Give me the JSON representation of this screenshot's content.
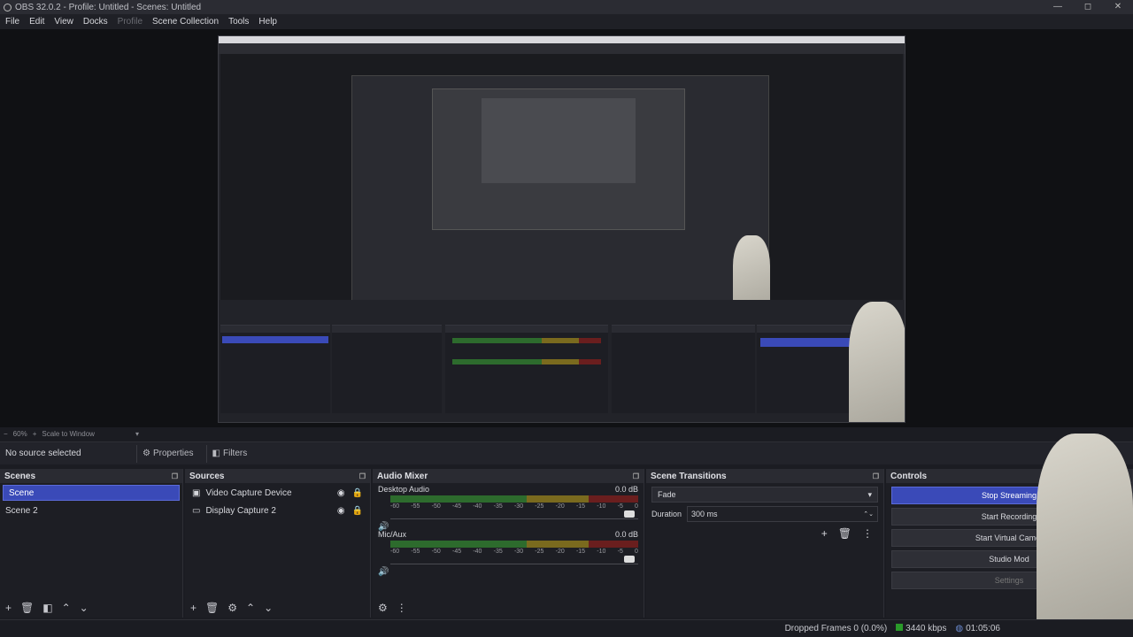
{
  "window": {
    "title": "OBS 32.0.2 - Profile: Untitled - Scenes: Untitled",
    "controls": [
      "—",
      "◻",
      "✕"
    ]
  },
  "menu": {
    "items": [
      {
        "label": "File",
        "disabled": false
      },
      {
        "label": "Edit",
        "disabled": false
      },
      {
        "label": "View",
        "disabled": false
      },
      {
        "label": "Docks",
        "disabled": false
      },
      {
        "label": "Profile",
        "disabled": true
      },
      {
        "label": "Scene Collection",
        "disabled": false
      },
      {
        "label": "Tools",
        "disabled": false
      },
      {
        "label": "Help",
        "disabled": false
      }
    ]
  },
  "preview_bar": {
    "zoom": "60%",
    "scale_mode": "Scale to Window"
  },
  "source_bar": {
    "no_source": "No source selected",
    "properties": "Properties",
    "filters": "Filters"
  },
  "scenes": {
    "title": "Scenes",
    "items": [
      "Scene",
      "Scene 2"
    ],
    "selected_index": 0
  },
  "sources": {
    "title": "Sources",
    "items": [
      {
        "label": "Video Capture Device",
        "icon": "camera-icon"
      },
      {
        "label": "Display Capture 2",
        "icon": "monitor-icon"
      }
    ]
  },
  "audio_mixer": {
    "title": "Audio Mixer",
    "channels": [
      {
        "name": "Desktop Audio",
        "level": "0.0 dB"
      },
      {
        "name": "Mic/Aux",
        "level": "0.0 dB"
      }
    ],
    "scale": [
      "-60",
      "-55",
      "-50",
      "-45",
      "-40",
      "-35",
      "-30",
      "-25",
      "-20",
      "-15",
      "-10",
      "-5",
      "0"
    ]
  },
  "transitions": {
    "title": "Scene Transitions",
    "selected": "Fade",
    "duration_label": "Duration",
    "duration_value": "300 ms"
  },
  "controls": {
    "title": "Controls",
    "buttons": [
      "Stop Streaming",
      "Start Recording",
      "Start Virtual Camer",
      "Studio Mod",
      "Settings"
    ]
  },
  "status": {
    "dropped_frames": "Dropped Frames 0 (0.0%)",
    "bitrate": "3440 kbps",
    "time": "01:05:06"
  },
  "colors": {
    "accent": "#3a4ab8",
    "background": "#1d1e24"
  }
}
